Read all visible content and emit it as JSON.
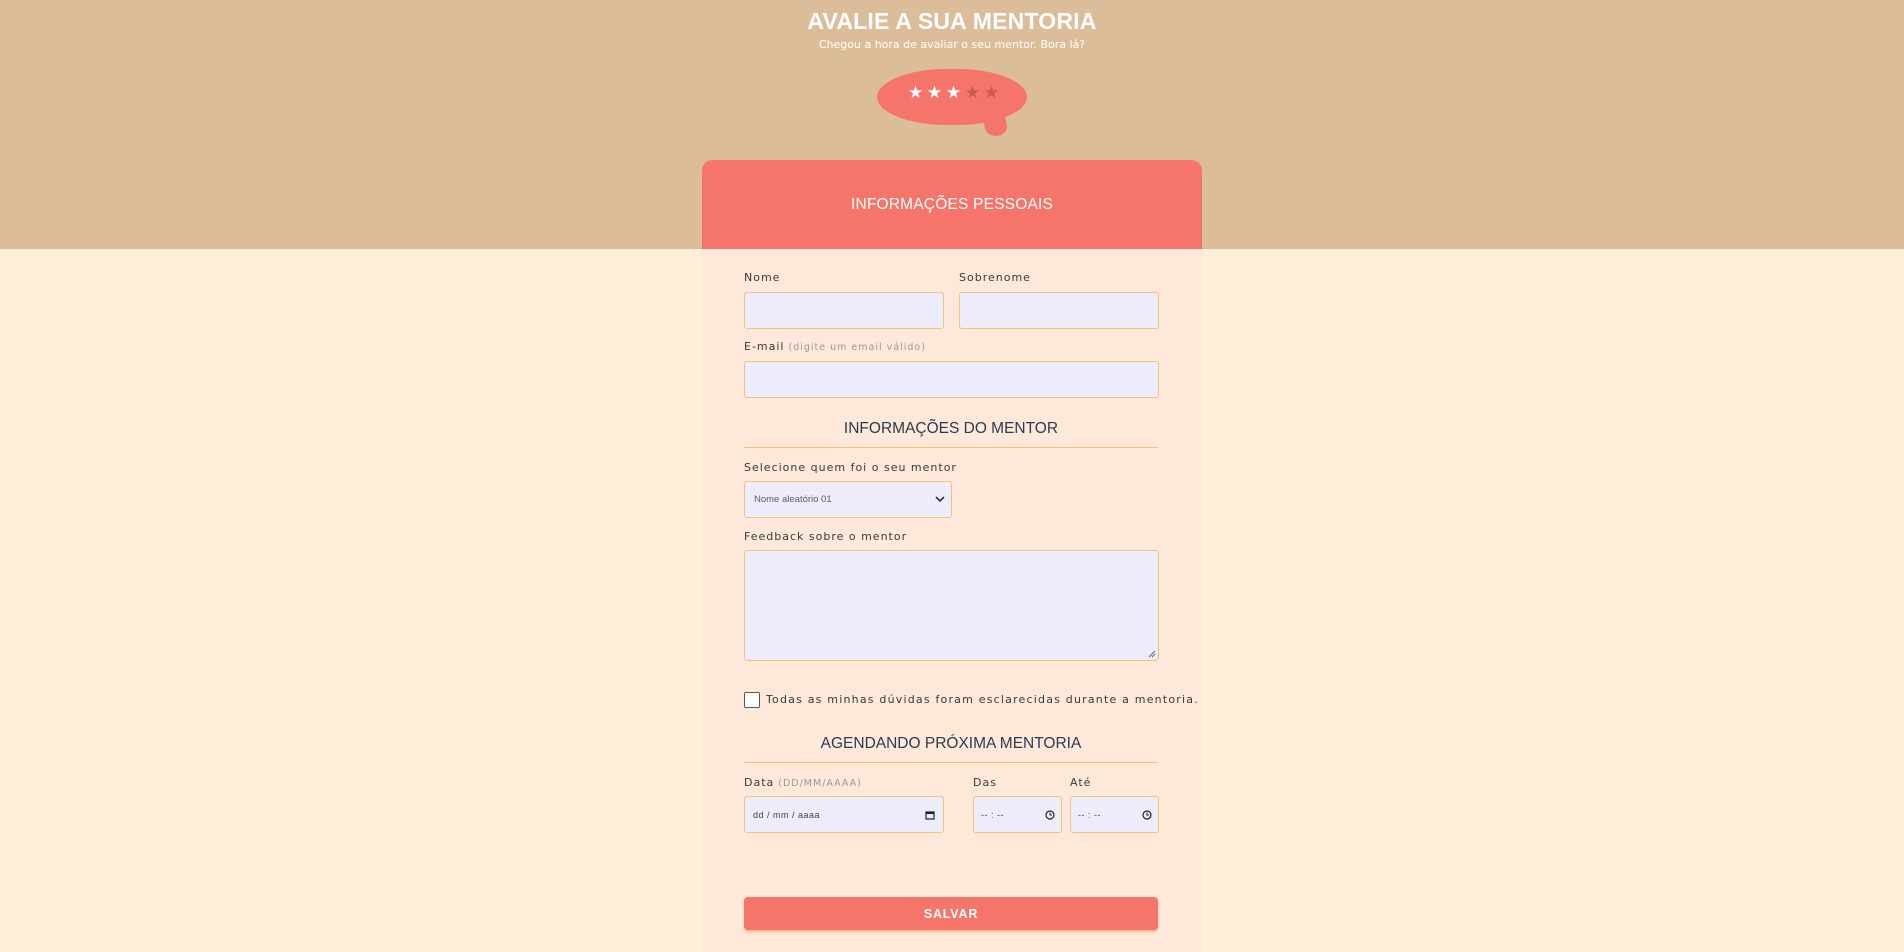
{
  "hero": {
    "title": "AVALIE A SUA MENTORIA",
    "subtitle": "Chegou a hora de avaliar o seu mentor. Bora lá?"
  },
  "rating": {
    "value": 3,
    "max": 5,
    "icon": "star-icon",
    "active_color": "#ffffff",
    "inactive_color": "#c95a50"
  },
  "card": {
    "header": "INFORMAÇÕES PESSOAIS"
  },
  "personal": {
    "nome_label": "Nome",
    "nome_value": "",
    "sobrenome_label": "Sobrenome",
    "sobrenome_value": "",
    "email_label": "E-mail",
    "email_hint": "(digite um email válido)",
    "email_value": ""
  },
  "mentor": {
    "section_title": "INFORMAÇÕES DO MENTOR",
    "select_label": "Selecione quem foi o seu mentor",
    "select_value": "Nome aleatório 01",
    "feedback_label": "Feedback sobre o mentor",
    "feedback_value": "",
    "checkbox_label": "Todas as minhas dúvidas foram esclarecidas durante a mentoria.",
    "checkbox_checked": false
  },
  "schedule": {
    "section_title": "AGENDANDO PRÓXIMA MENTORIA",
    "date_label": "Data",
    "date_hint": "(DD/MM/AAAA)",
    "date_placeholder": "dd / mm / aaaa",
    "from_label": "Das",
    "from_placeholder": "-- : --",
    "to_label": "Até",
    "to_placeholder": "-- : --"
  },
  "actions": {
    "save_label": "SALVAR"
  },
  "colors": {
    "accent": "#f5756a",
    "top_band": "#dcbd9a",
    "page_bg": "#fcefd6",
    "card_bg": "#fde8da",
    "input_bg": "#ececfa",
    "input_border": "#f0c27a"
  }
}
